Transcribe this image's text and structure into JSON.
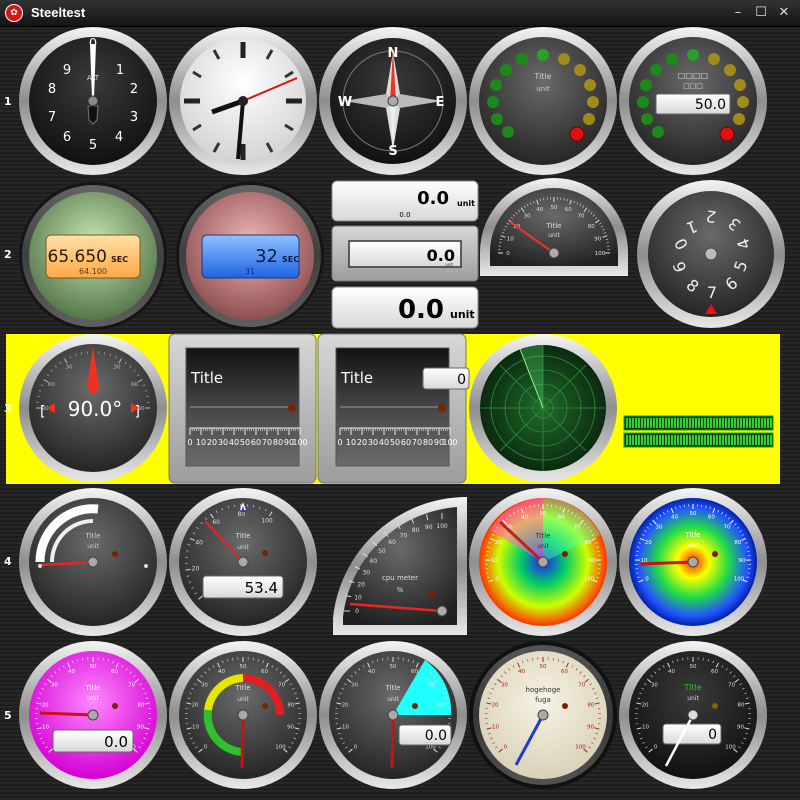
{
  "window": {
    "title": "Steeltest",
    "minimize": "–",
    "maximize": "☐",
    "close": "✕"
  },
  "row_labels": [
    "1",
    "2",
    "3",
    "4",
    "5"
  ],
  "row1": {
    "altimeter": {
      "numbers": [
        "9",
        "0",
        "1",
        "2",
        "3",
        "4",
        "5",
        "6",
        "7",
        "8"
      ],
      "mark": "ALT"
    },
    "compass": {
      "n": "N",
      "e": "E",
      "s": "S",
      "w": "W"
    },
    "led_gauge_a": {
      "title": "Title",
      "unit": "unit"
    },
    "led_gauge_b": {
      "display": "50.0",
      "title_boxes": "□□□□",
      "unit_boxes": "□□□"
    }
  },
  "row2": {
    "lcd_green": {
      "value": "65.650",
      "unit": "SEC",
      "sub": "64.100"
    },
    "lcd_red": {
      "value": "32",
      "unit": "SEC",
      "sub": "31"
    },
    "display_single": {
      "value": "0.0",
      "unit": "unit",
      "sub": "0.0"
    },
    "display_middle": {
      "value": "0.0",
      "unit": "unit"
    },
    "display_big": {
      "value": "0.0",
      "unit": "unit"
    },
    "half_gauge": {
      "title": "Title",
      "unit": "unit",
      "ticks": [
        "0",
        "10",
        "20",
        "30",
        "40",
        "50",
        "60",
        "70",
        "80",
        "90",
        "100"
      ]
    },
    "odometer_dial": {
      "numbers": [
        "0",
        "1",
        "2",
        "3",
        "4",
        "5",
        "6",
        "7",
        "8",
        "9"
      ]
    }
  },
  "row3": {
    "horizon": {
      "value": "90.0°",
      "ticks": [
        "90",
        "60",
        "30",
        "0",
        "30",
        "60",
        "90"
      ]
    },
    "linear_a": {
      "title": "Title",
      "ticks": [
        "0",
        "10",
        "20",
        "30",
        "40",
        "50",
        "60",
        "70",
        "80",
        "90",
        "100"
      ]
    },
    "linear_b": {
      "title": "Title",
      "value": "0",
      "ticks": [
        "0",
        "10",
        "20",
        "30",
        "40",
        "50",
        "60",
        "70",
        "80",
        "90",
        "100"
      ]
    }
  },
  "row4": {
    "bar_gauge": {
      "title": "Title",
      "unit": "unit"
    },
    "radial_lcd": {
      "title": "Title",
      "unit": "unit",
      "value": "53.4",
      "ticks": [
        "0",
        "20",
        "40",
        "60",
        "80",
        "100"
      ]
    },
    "quarter_gauge": {
      "title": "cpu meter",
      "unit": "%",
      "ticks": [
        "0",
        "10",
        "20",
        "30",
        "40",
        "50",
        "60",
        "70",
        "80",
        "90",
        "100"
      ]
    },
    "rainbow_gauge": {
      "title": "Title",
      "unit": "unit",
      "ticks": [
        "0",
        "10",
        "20",
        "30",
        "40",
        "50",
        "60",
        "70",
        "80",
        "90",
        "100"
      ]
    },
    "radial_colorful": {
      "title": "Title",
      "unit": "unit",
      "ticks": [
        "0",
        "10",
        "20",
        "30",
        "40",
        "50",
        "60",
        "70",
        "80",
        "90",
        "100"
      ]
    }
  },
  "row5": {
    "magenta_gauge": {
      "title": "Title",
      "unit": "unit",
      "value": "0.0",
      "ticks": [
        "0",
        "10",
        "20",
        "30",
        "40",
        "50",
        "60",
        "70",
        "80",
        "90",
        "100"
      ]
    },
    "sections_gauge": {
      "title": "Title",
      "unit": "unit",
      "ticks": [
        "0",
        "10",
        "20",
        "30",
        "40",
        "50",
        "60",
        "70",
        "80",
        "90",
        "100"
      ]
    },
    "area_gauge": {
      "title": "Title",
      "unit": "unit",
      "value": "0.0",
      "ticks": [
        "0",
        "10",
        "20",
        "30",
        "40",
        "50",
        "60",
        "70",
        "80",
        "90",
        "100"
      ]
    },
    "beige_gauge": {
      "title": "hogehoge",
      "unit": "fuga",
      "ticks": [
        "0",
        "10",
        "20",
        "30",
        "40",
        "50",
        "60",
        "70",
        "80",
        "90",
        "100"
      ]
    },
    "last_gauge": {
      "title": "Title",
      "unit": "unit",
      "value": "0",
      "ticks": [
        "0",
        "10",
        "20",
        "30",
        "40",
        "50",
        "60",
        "70",
        "80",
        "90",
        "100"
      ]
    }
  },
  "colors": {
    "yellow_panel": "#ffff00",
    "led_green": "#22aa22",
    "led_red": "#dd1111",
    "lcd_orange": "#ffb357",
    "lcd_blue": "#2f7ff0",
    "cyan_area": "#22ffff",
    "magenta": "#ff00ff"
  }
}
